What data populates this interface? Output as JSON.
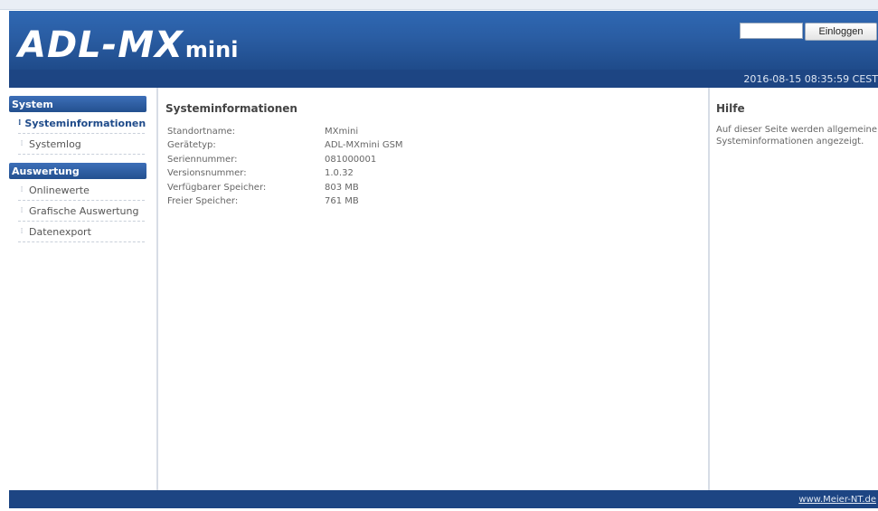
{
  "header": {
    "logo_main": "ADL-MX",
    "logo_sub": "mini",
    "login_input_value": "",
    "login_button_label": "Einloggen"
  },
  "datebar": {
    "datetime": "2016-08-15 08:35:59 CEST"
  },
  "sidebar": {
    "sections": [
      {
        "title": "System",
        "items": [
          {
            "label": "Systeminformationen",
            "active": true
          },
          {
            "label": "Systemlog",
            "active": false
          }
        ]
      },
      {
        "title": "Auswertung",
        "items": [
          {
            "label": "Onlinewerte",
            "active": false
          },
          {
            "label": "Grafische Auswertung",
            "active": false
          },
          {
            "label": "Datenexport",
            "active": false
          }
        ]
      }
    ]
  },
  "main": {
    "title": "Systeminformationen",
    "rows": [
      {
        "label": "Standortname:",
        "value": "MXmini"
      },
      {
        "label": "Gerätetyp:",
        "value": "ADL-MXmini GSM"
      },
      {
        "label": "Seriennummer:",
        "value": "081000001"
      },
      {
        "label": "Versionsnummer:",
        "value": "1.0.32"
      },
      {
        "label": "Verfügbarer Speicher:",
        "value": "803 MB"
      },
      {
        "label": "Freier Speicher:",
        "value": "761 MB"
      }
    ]
  },
  "help": {
    "title": "Hilfe",
    "text": "Auf dieser Seite werden allgemeine Systeminformationen angezeigt."
  },
  "footer": {
    "link": "www.Meier-NT.de"
  }
}
